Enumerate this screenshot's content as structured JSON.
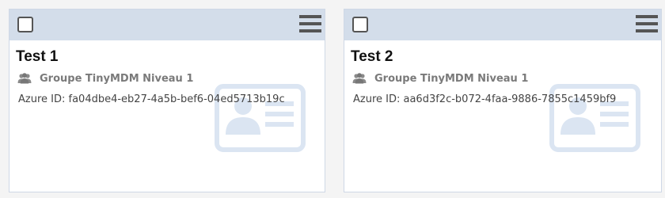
{
  "cards": [
    {
      "title": "Test 1",
      "group": "Groupe TinyMDM Niveau 1",
      "azure_id": "Azure ID: fa04dbe4-eb27-4a5b-bef6-04ed5713b19c",
      "group_icon": "users-icon",
      "background_icon": "id-card-icon"
    },
    {
      "title": "Test 2",
      "group": "Groupe TinyMDM Niveau 1",
      "azure_id": "Azure ID: aa6d3f2c-b072-4faa-9886-7855c1459bf9",
      "group_icon": "users-icon",
      "background_icon": "id-card-icon"
    }
  ],
  "colors": {
    "header_bg": "#d3ddea",
    "card_border": "#cfd8e6",
    "id_icon": "#dbe5f2",
    "icon_dark": "#555555",
    "group_text": "#7a7a7a"
  }
}
